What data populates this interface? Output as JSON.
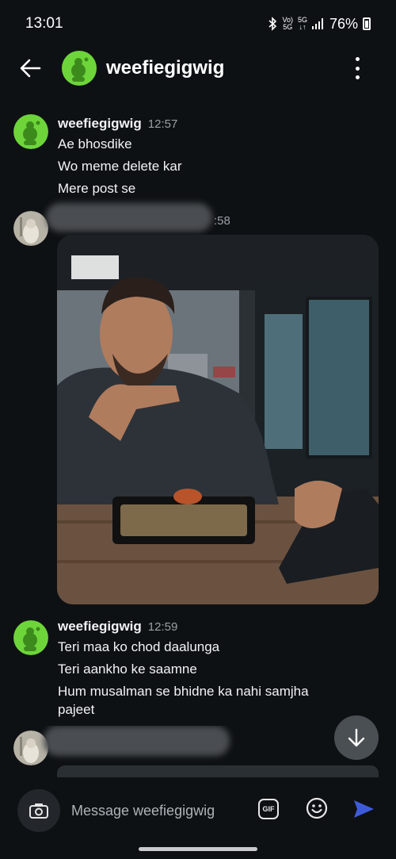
{
  "status_bar": {
    "time": "13:01",
    "network_top": "Vo)",
    "network_bottom": "5G",
    "data_top": "5G",
    "data_bottom": "↓↑",
    "battery": "76%"
  },
  "header": {
    "title": "weefiegigwig"
  },
  "messages": [
    {
      "sender": "weefiegigwig",
      "time": "12:57",
      "lines": [
        "Ae bhosdike",
        "Wo meme delete kar",
        "Mere post se"
      ]
    },
    {
      "time_partial": ":58"
    },
    {
      "sender": "weefiegigwig",
      "time": "12:59",
      "lines": [
        "Teri maa ko chod daalunga",
        "Teri aankho ke saamne",
        "Hum musalman se bhidne ka nahi samjha",
        "pajeet"
      ]
    }
  ],
  "composer": {
    "placeholder": "Message weefiegigwig",
    "gif_label": "GIF"
  },
  "colors": {
    "background": "#0e1114",
    "snoo_green": "#6dd53a",
    "send_blue": "#3d5bd9"
  }
}
